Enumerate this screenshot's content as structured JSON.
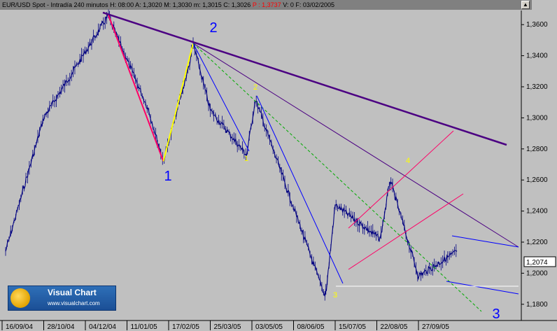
{
  "header": {
    "symbol": "EUR/USD Spot - Intradía 240 minutos",
    "h": "H: 08:00",
    "a": "A: 1,3020",
    "m": "M: 1,3030",
    "mn": "m: 1,3015",
    "c": "C: 1,3026",
    "p": "P : 1,3737",
    "v": "V: 0",
    "f": "F: 03/02/2005",
    "scroll_glyph": "▲"
  },
  "logo": {
    "title": "Visual Chart",
    "url": "www.visualchart.com"
  },
  "chart_data": {
    "type": "line",
    "ylim": [
      1.17,
      1.37
    ],
    "y_ticks": [
      "1,3600",
      "1,3400",
      "1,3200",
      "1,3000",
      "1,2800",
      "1,2600",
      "1,2400",
      "1,2200",
      "1,2000",
      "1,1800"
    ],
    "x_ticks": [
      "16/09/04",
      "28/10/04",
      "04/12/04",
      "11/01/05",
      "17/02/05",
      "25/03/05",
      "03/05/05",
      "08/06/05",
      "15/07/05",
      "22/08/05",
      "27/09/05"
    ],
    "last_price": "1,2074",
    "series": [
      {
        "x": [
          "16/09/04",
          "28/10/04",
          "04/12/04",
          "04/12/04",
          "11/01/05",
          "11/01/05",
          "17/02/05",
          "17/02/05",
          "25/03/05",
          "25/03/05",
          "03/05/05",
          "08/06/05",
          "08/06/05",
          "15/07/05",
          "22/08/05",
          "22/08/05",
          "27/09/05",
          "27/09/05"
        ],
        "y": [
          1.214,
          1.3,
          1.366,
          1.362,
          1.306,
          1.272,
          1.335,
          1.348,
          1.305,
          1.276,
          1.312,
          1.186,
          1.19,
          1.244,
          1.222,
          1.26,
          1.198,
          1.214
        ]
      }
    ],
    "annotations": {
      "wave_labels": [
        "1",
        "2",
        "3",
        "1",
        "2",
        "3",
        "4"
      ],
      "colors": {
        "trend": "#4b0082",
        "channel": "#ff0066",
        "wedge": "#0000ff",
        "impulse": "#ffff00",
        "dashed": "#00aa00",
        "support": "#ffffff"
      }
    }
  }
}
